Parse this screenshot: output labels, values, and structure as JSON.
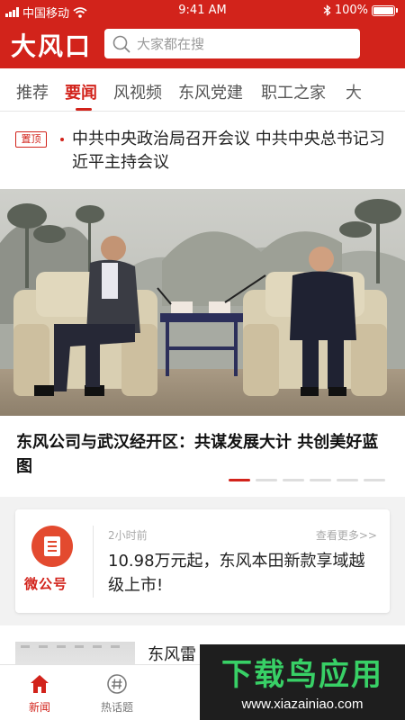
{
  "status_bar": {
    "carrier": "中国移动",
    "time": "9:41 AM",
    "battery": "100%"
  },
  "header": {
    "logo": "大风口",
    "search_placeholder": "大家都在搜"
  },
  "tabs": [
    {
      "label": "推荐",
      "active": false
    },
    {
      "label": "要闻",
      "active": true
    },
    {
      "label": "风视频",
      "active": false
    },
    {
      "label": "东风党建",
      "active": false
    },
    {
      "label": "职工之家",
      "active": false
    },
    {
      "label": "大",
      "active": false
    }
  ],
  "pinned": {
    "badge": "置顶",
    "title": "中共中央政治局召开会议 中共中央总书记习近平主持会议"
  },
  "hero": {
    "caption": "东风公司与武汉经开区：共谋发展大计 共创美好蓝图",
    "slides": 6,
    "active_slide": 1
  },
  "official_card": {
    "icon_label": "微公号",
    "time": "2小时前",
    "more": "查看更多>>",
    "title": "10.98万元起，东风本田新款享域越级上市!"
  },
  "list_item": {
    "title": "东风雷"
  },
  "bottom_nav": [
    {
      "label": "新闻",
      "icon": "home-icon",
      "active": true
    },
    {
      "label": "热话题",
      "icon": "hashtag-icon",
      "active": false
    }
  ],
  "watermark": {
    "title": "下载鸟应用",
    "url": "www.xiazainiao.com"
  },
  "colors": {
    "brand_red": "#d2231b",
    "watermark_green": "#38d066"
  }
}
